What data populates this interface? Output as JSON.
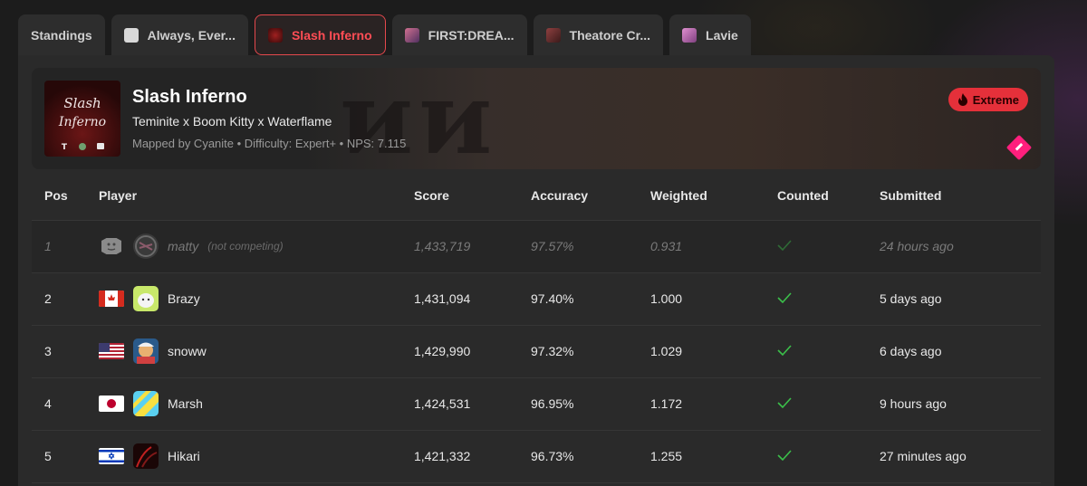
{
  "tabs": [
    {
      "label": "Standings",
      "thumb": "",
      "active": false
    },
    {
      "label": "Always, Ever...",
      "thumb": "#d8d8d8",
      "active": false
    },
    {
      "label": "Slash Inferno",
      "thumb": "#6a1a1a",
      "active": true
    },
    {
      "label": "FIRST:DREA...",
      "thumb": "#a05070",
      "active": false
    },
    {
      "label": "Theatore Cr...",
      "thumb": "#703a3a",
      "active": false
    },
    {
      "label": "Lavie",
      "thumb": "#c070b0",
      "active": false
    }
  ],
  "banner": {
    "title": "Slash Inferno",
    "artists": "Teminite x Boom Kitty x Waterflame",
    "meta": "Mapped by Cyanite • Difficulty: Expert+ • NPS: 7.115",
    "difficulty_badge": "Extreme",
    "badge_color": "#e5303a",
    "accent_icon": "diamond-icon"
  },
  "table": {
    "headers": [
      "Pos",
      "Player",
      "Score",
      "Accuracy",
      "Weighted",
      "Counted",
      "Submitted"
    ],
    "rows": [
      {
        "pos": "1",
        "country": "neutral",
        "name": "matty",
        "note": "(not competing)",
        "score": "1,433,719",
        "accuracy": "97.57%",
        "weighted": "0.931",
        "submitted": "24 hours ago",
        "competing": false
      },
      {
        "pos": "2",
        "country": "CA",
        "name": "Brazy",
        "note": "",
        "score": "1,431,094",
        "accuracy": "97.40%",
        "weighted": "1.000",
        "submitted": "5 days ago",
        "competing": true
      },
      {
        "pos": "3",
        "country": "US",
        "name": "snoww",
        "note": "",
        "score": "1,429,990",
        "accuracy": "97.32%",
        "weighted": "1.029",
        "submitted": "6 days ago",
        "competing": true
      },
      {
        "pos": "4",
        "country": "JP",
        "name": "Marsh",
        "note": "",
        "score": "1,424,531",
        "accuracy": "96.95%",
        "weighted": "1.172",
        "submitted": "9 hours ago",
        "competing": true
      },
      {
        "pos": "5",
        "country": "IL",
        "name": "Hikari",
        "note": "",
        "score": "1,421,332",
        "accuracy": "96.73%",
        "weighted": "1.255",
        "submitted": "27 minutes ago",
        "competing": true
      }
    ]
  },
  "colors": {
    "accent": "#ff4d55",
    "check": "#3bbf4a"
  }
}
